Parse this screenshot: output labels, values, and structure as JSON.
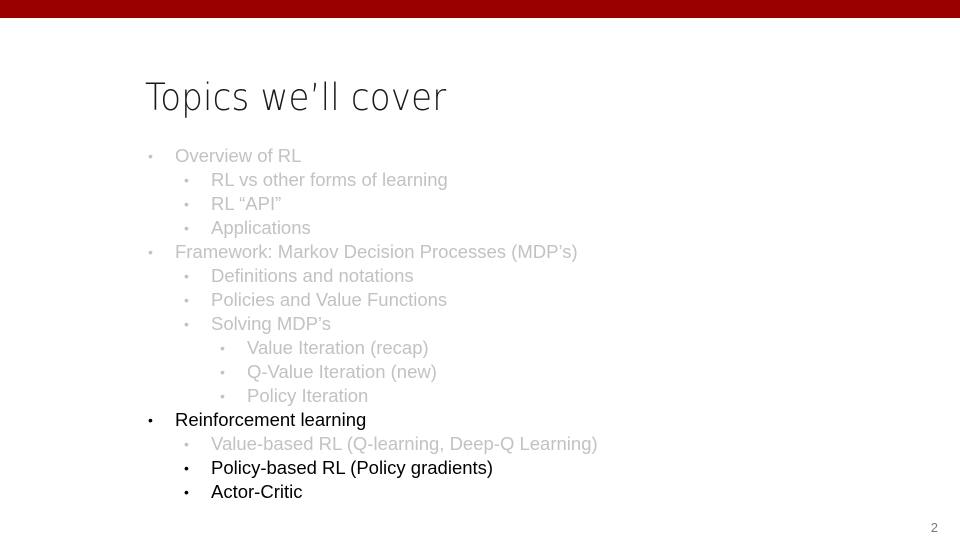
{
  "slide": {
    "title": "Topics we’ll cover",
    "page_number": "2",
    "accent_color": "#990000",
    "bullet_glyph": "•",
    "items": [
      {
        "level": 0,
        "text": "Overview of RL",
        "state": "faded"
      },
      {
        "level": 1,
        "text": "RL vs other forms of learning",
        "state": "faded"
      },
      {
        "level": 1,
        "text": "RL “API”",
        "state": "faded"
      },
      {
        "level": 1,
        "text": "Applications",
        "state": "faded"
      },
      {
        "level": 0,
        "text": "Framework: Markov Decision Processes (MDP’s)",
        "state": "faded"
      },
      {
        "level": 1,
        "text": "Definitions and notations",
        "state": "faded"
      },
      {
        "level": 1,
        "text": "Policies and Value Functions",
        "state": "faded"
      },
      {
        "level": 1,
        "text": "Solving MDP’s",
        "state": "faded"
      },
      {
        "level": 2,
        "text": "Value Iteration (recap)",
        "state": "faded"
      },
      {
        "level": 2,
        "text": "Q-Value Iteration (new)",
        "state": "faded"
      },
      {
        "level": 2,
        "text": "Policy Iteration",
        "state": "faded"
      },
      {
        "level": 0,
        "text": "Reinforcement learning",
        "state": "active"
      },
      {
        "level": 1,
        "text": "Value-based RL (Q-learning, Deep-Q Learning)",
        "state": "faded"
      },
      {
        "level": 1,
        "text": "Policy-based RL (Policy gradients)",
        "state": "active"
      },
      {
        "level": 1,
        "text": "Actor-Critic",
        "state": "active"
      }
    ]
  }
}
